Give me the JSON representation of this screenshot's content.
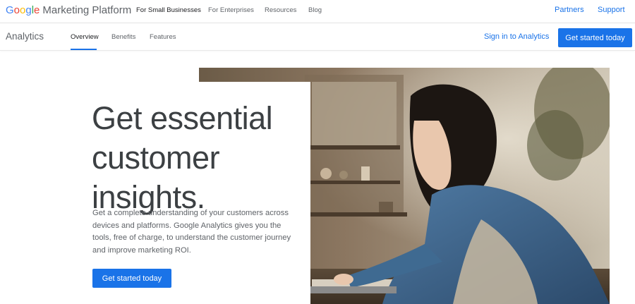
{
  "brand": {
    "google_letters": [
      {
        "ch": "G",
        "color": "#4285F4"
      },
      {
        "ch": "o",
        "color": "#EA4335"
      },
      {
        "ch": "o",
        "color": "#FBBC05"
      },
      {
        "ch": "g",
        "color": "#4285F4"
      },
      {
        "ch": "l",
        "color": "#34A853"
      },
      {
        "ch": "e",
        "color": "#EA4335"
      }
    ],
    "suffix": "Marketing Platform"
  },
  "topnav": {
    "items": [
      "For Small Businesses",
      "For Enterprises",
      "Resources",
      "Blog"
    ],
    "active_index": 0
  },
  "topright": {
    "partners": "Partners",
    "support": "Support"
  },
  "subnav": {
    "product": "Analytics",
    "tabs": [
      "Overview",
      "Benefits",
      "Features"
    ],
    "active_index": 0,
    "signin": "Sign in to Analytics",
    "cta": "Get started today"
  },
  "hero": {
    "headline": "Get essential customer insights.",
    "description": "Get a complete understanding of your customers across devices and platforms. Google Analytics gives you the tools, free of charge, to understand the customer journey and improve marketing ROI.",
    "cta": "Get started today",
    "image_alt": "woman-typing-on-laptop-photo"
  },
  "colors": {
    "accent": "#1a73e8",
    "text_dark": "#3c4043",
    "text_muted": "#5f6368"
  }
}
